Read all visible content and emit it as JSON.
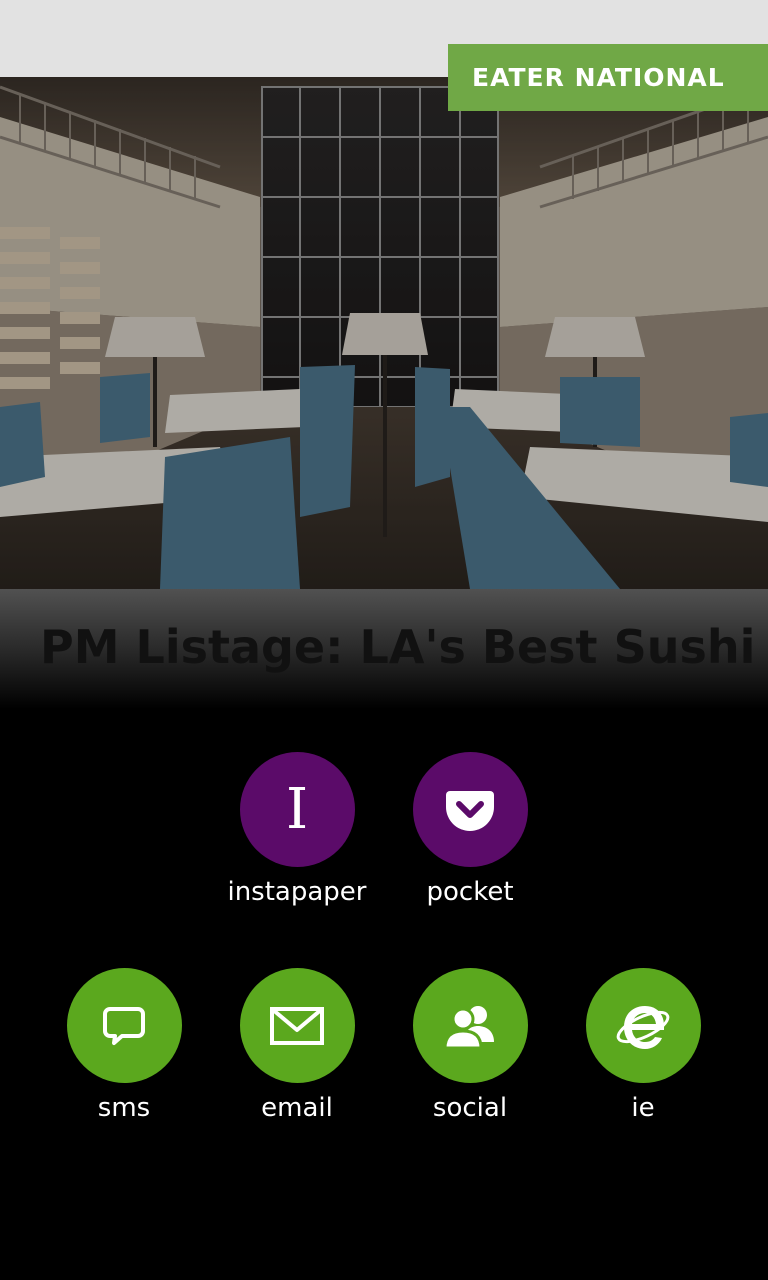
{
  "source": {
    "label": "EATER NATIONAL",
    "color": "#70a846"
  },
  "article": {
    "headline": "PM Listage: LA's Best Sushi Restaurants, The"
  },
  "share": {
    "read_later": [
      {
        "label": "instapaper",
        "icon": "instapaper-icon",
        "color": "#5b0b69"
      },
      {
        "label": "pocket",
        "icon": "pocket-icon",
        "color": "#5b0b69"
      }
    ],
    "send": [
      {
        "label": "sms",
        "icon": "sms-icon",
        "color": "#5ba81e"
      },
      {
        "label": "email",
        "icon": "email-icon",
        "color": "#5ba81e"
      },
      {
        "label": "social",
        "icon": "social-icon",
        "color": "#5ba81e"
      },
      {
        "label": "ie",
        "icon": "ie-icon",
        "color": "#5ba81e"
      }
    ]
  }
}
